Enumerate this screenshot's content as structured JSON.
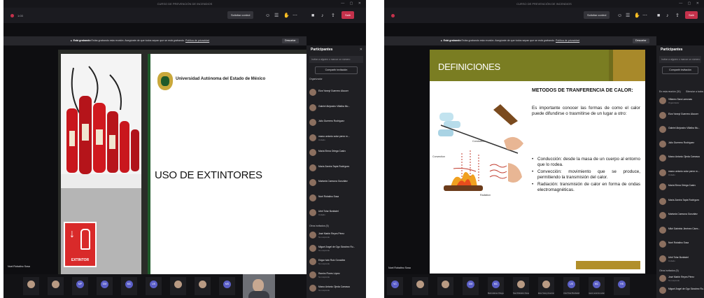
{
  "meeting_title": "CURSO DE PREVENCIÓN DE INCENDIOS",
  "toolbar": {
    "share_control": "Solicitar control",
    "leave": "Salir",
    "time": "1:03"
  },
  "banner": {
    "strong": "Está grabando",
    "text": "Estás grabando esta reunión. Asegúrate de que todos sepan que se está grabando.",
    "link": "Política de privacidad",
    "dismiss": "Descartar"
  },
  "participants_panel": {
    "title": "Participantes",
    "search_placeholder": "Invitar a alguien o marcar un número",
    "share_invite": "Compartir invitación",
    "organizer_section": "Organizador",
    "others_section": "Otros invitados (5)",
    "right_section_a": "En esta reunión (31)",
    "right_section_b": "Silenciar a todos",
    "right_others_section": "Otros invitados (5)",
    "left_rows": [
      {
        "name": "Elva Yaneyi Guerrero Alcocer",
        "sub": ""
      },
      {
        "name": "Gabriel Alejandro Villalba Mu...",
        "sub": ""
      },
      {
        "name": "Julio Guerrero Rodríguez",
        "sub": ""
      },
      {
        "name": "marco antonio solar perez m...",
        "sub": "Invitado"
      },
      {
        "name": "María Elena Ortega Castro",
        "sub": ""
      },
      {
        "name": "María Zamira Tapia Rodríguez",
        "sub": ""
      },
      {
        "name": "Marisela Carmona González",
        "sub": ""
      },
      {
        "name": "Noel Robalino Sosa",
        "sub": ""
      },
      {
        "name": "Uriel Tolar Bonfadeli",
        "sub": "Invitado"
      }
    ],
    "left_other_rows": [
      {
        "name": "José Martín Reyes Pérez",
        "sub": "No responde"
      },
      {
        "name": "Miguel Ángel de Ogo Sánchez Ru...",
        "sub": "No responde"
      },
      {
        "name": "Edgar Iván Ruiz González",
        "sub": "No responde"
      },
      {
        "name": "Ramiro Flores López",
        "sub": "No responde"
      },
      {
        "name": "Marco Antonio Ojeda Carrasco",
        "sub": "No responde"
      }
    ],
    "right_rows": [
      {
        "name": "Villaneo Sara Lamonas",
        "sub": "Organizador"
      },
      {
        "name": "Elva Yaneyi Guerrero Alcocer",
        "sub": ""
      },
      {
        "name": "Gabriel Alejandro Villalba Mu...",
        "sub": ""
      },
      {
        "name": "Julio Guerrero Rodríguez",
        "sub": ""
      },
      {
        "name": "Marco Antonio Ojeda Carrasco",
        "sub": ""
      },
      {
        "name": "marco antonio solar perez m...",
        "sub": "Invitado"
      },
      {
        "name": "María Elena Ortega Castro",
        "sub": ""
      },
      {
        "name": "María Zamira Tapia Rodríguez",
        "sub": ""
      },
      {
        "name": "Marisela Carmona González",
        "sub": ""
      },
      {
        "name": "Mitzi Gabriela Jiménez Cárm...",
        "sub": ""
      },
      {
        "name": "Noel Robalino Sosa",
        "sub": ""
      },
      {
        "name": "Uriel Tolar Bonfadeli",
        "sub": "Invitado"
      }
    ],
    "right_other_rows": [
      {
        "name": "José Martín Reyes Pérez",
        "sub": "No responde"
      },
      {
        "name": "Miguel Ángel de Ogo Sánchez Ru...",
        "sub": ""
      }
    ]
  },
  "presenter_name": "Noel Robalino Sosa",
  "left_strip": [
    {
      "initials": "",
      "name": "",
      "photo": true
    },
    {
      "initials": "",
      "name": "",
      "photo": true
    },
    {
      "initials": "MP",
      "name": ""
    },
    {
      "initials": "GM",
      "name": ""
    },
    {
      "initials": "MC",
      "name": ""
    },
    {
      "initials": "US",
      "name": ""
    },
    {
      "initials": "",
      "name": "",
      "photo": true
    },
    {
      "initials": "",
      "name": "",
      "photo": true
    },
    {
      "initials": "MS",
      "name": ""
    }
  ],
  "right_strip": [
    {
      "initials": "VC",
      "name": ""
    },
    {
      "initials": "",
      "name": "",
      "photo": true
    },
    {
      "initials": "",
      "name": "",
      "photo": true
    },
    {
      "initials": "GM",
      "name": ""
    },
    {
      "initials": "MC",
      "name": "María Elena Ortega C..."
    },
    {
      "initials": "",
      "name": "Noel Robalino Sosa",
      "photo": true
    },
    {
      "initials": "",
      "name": "Elva Yaneyi Guerrero...",
      "photo": true
    },
    {
      "initials": "US",
      "name": "Uriel Tolar Bonfadeli"
    },
    {
      "initials": "MC",
      "name": "marco antonio solar p..."
    },
    {
      "initials": "HS",
      "name": ""
    }
  ],
  "slide_left": {
    "university": "Universidad Autónoma del Estado de México",
    "title": "USO DE EXTINTORES",
    "sign_label": "EXTINTOR"
  },
  "slide_right": {
    "title": "DEFINICIONES",
    "heading": "METODOS DE TRANFERENCIA DE CALOR:",
    "intro": "Es importante conocer las formas de como el calor puede difundirse o trasmitirse de un lugar a otro:",
    "bullets": [
      "Conducción: desde la masa de un cuerpo al entorno que lo rodea.",
      "Convección: movimiento que se produce, permitiendo la transmisión del calor.",
      "Radiación: transmisión de calor en forma de ondas electromagnéticas."
    ],
    "labels": {
      "conduction": "Conduction",
      "convection": "Convection",
      "radiation": "Radiation"
    }
  },
  "colors": {
    "leave": "#c4314b",
    "accent": "#5b5fc7",
    "uaem_green": "#1f5a2a",
    "slide_olive": "#7a7d22",
    "slide_gold": "#a8892a"
  }
}
